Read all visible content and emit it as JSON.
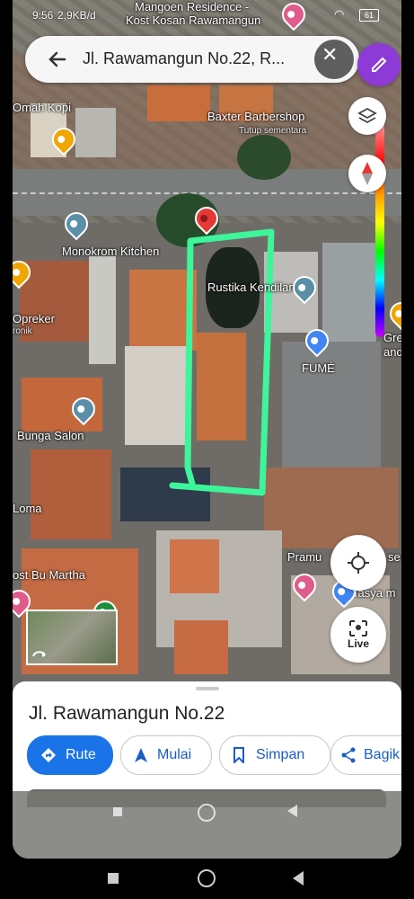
{
  "status": {
    "time": "9:56",
    "speed": "2,9KB/d",
    "battery": "61"
  },
  "search": {
    "query": "Jl. Rawamangun No.22, R..."
  },
  "map_labels": {
    "top_place_1": "Mangoen Residence -",
    "top_place_2": "Kost Kosan Rawamangun",
    "omah_kopi": "Omah Kopi",
    "baxter": "Baxter Barbershop",
    "baxter_status": "Tutup sementara",
    "monokrom": "Monokrom Kitchen",
    "rustika": "Rustika Kendilan",
    "opreker": "Opreker",
    "opreker_sub": "ronik",
    "fume": "FUMÉ",
    "gre": "Gre",
    "gre_sub": "and",
    "bunga": "Bunga Salon",
    "loma": "Loma",
    "kost_martha": "ost Bu Martha",
    "pramu": "Pramu",
    "pramu_tail": "se",
    "tasya": "Tasya m"
  },
  "live_label": "Live",
  "sheet": {
    "title": "Jl. Rawamangun No.22",
    "actions": [
      {
        "label": "Rute"
      },
      {
        "label": "Mulai"
      },
      {
        "label": "Simpan"
      },
      {
        "label": "Bagik"
      }
    ]
  },
  "colors": {
    "primary": "#1a73e8",
    "route_chip_text": "#ffffff",
    "action_text": "#1a5dc8",
    "marker_red": "#e53935",
    "highlight": "#3df59a",
    "draw_btn": "#8e3ad6"
  }
}
